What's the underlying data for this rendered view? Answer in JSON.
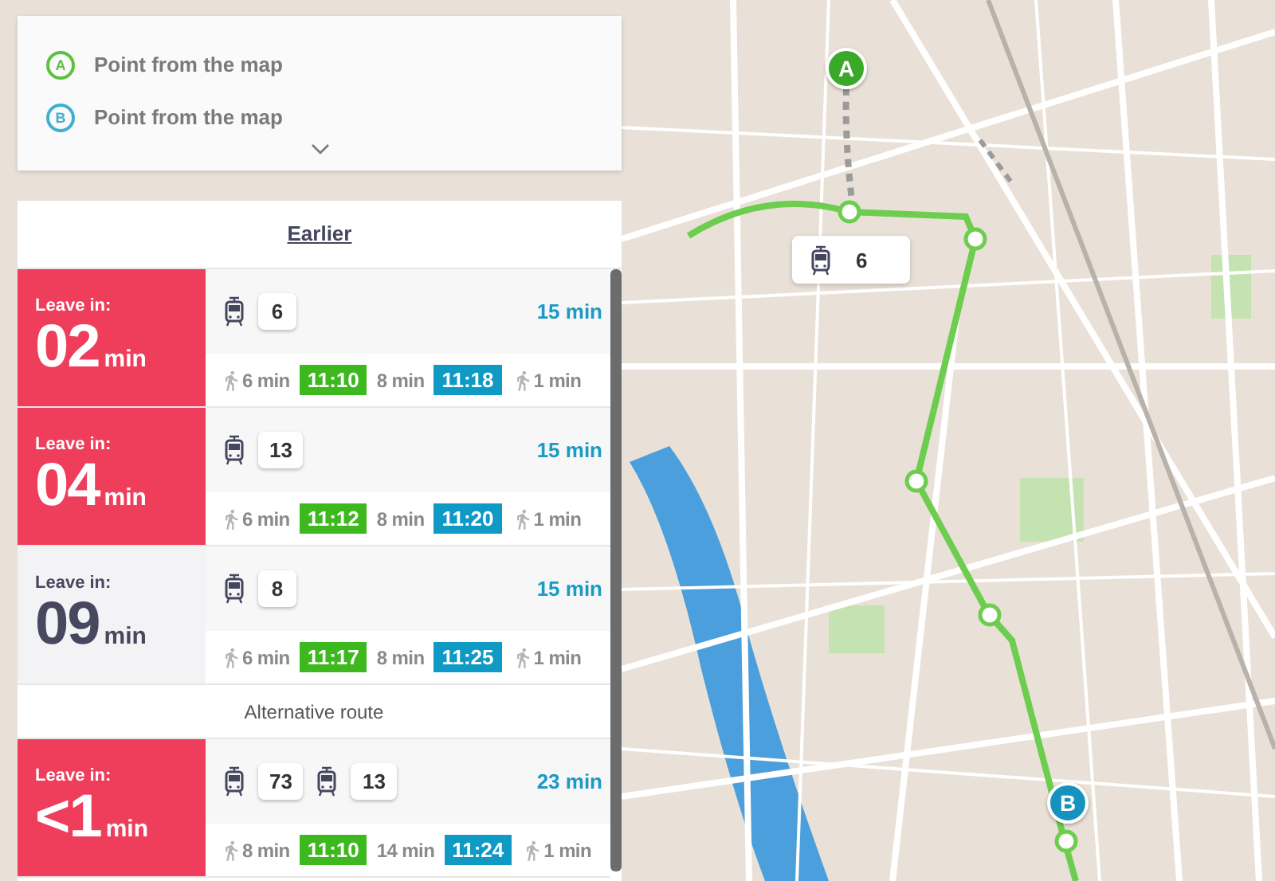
{
  "points": [
    {
      "letter": "A",
      "label": "Point from the map",
      "color": "#5cc13d"
    },
    {
      "letter": "B",
      "label": "Point from the map",
      "color": "#3fb0d0"
    }
  ],
  "earlier": "Earlier",
  "items": [
    {
      "kind": "route",
      "urgent": true,
      "leave_label": "Leave in:",
      "leave_value": "02",
      "leave_unit": "min",
      "lines": [
        "6"
      ],
      "duration": "15 min",
      "walk_start": "6 min",
      "depart": "11:10",
      "ride": "8 min",
      "arrive": "11:18",
      "walk_end": "1 min"
    },
    {
      "kind": "route",
      "urgent": true,
      "leave_label": "Leave in:",
      "leave_value": "04",
      "leave_unit": "min",
      "lines": [
        "13"
      ],
      "duration": "15 min",
      "walk_start": "6 min",
      "depart": "11:12",
      "ride": "8 min",
      "arrive": "11:20",
      "walk_end": "1 min"
    },
    {
      "kind": "route",
      "urgent": false,
      "leave_label": "Leave in:",
      "leave_value": "09",
      "leave_unit": "min",
      "lines": [
        "8"
      ],
      "duration": "15 min",
      "walk_start": "6 min",
      "depart": "11:17",
      "ride": "8 min",
      "arrive": "11:25",
      "walk_end": "1 min"
    },
    {
      "kind": "divider",
      "label": "Alternative route"
    },
    {
      "kind": "route",
      "urgent": true,
      "leave_label": "Leave in:",
      "leave_value": "<1",
      "leave_unit": "min",
      "lines": [
        "73",
        "13"
      ],
      "duration": "23 min",
      "walk_start": "8 min",
      "depart": "11:10",
      "ride": "14 min",
      "arrive": "11:24",
      "walk_end": "1 min"
    }
  ],
  "map": {
    "markers": [
      {
        "letter": "A",
        "color": "#3aa829"
      },
      {
        "letter": "B",
        "color": "#1592bd"
      }
    ],
    "line_label": "6"
  }
}
